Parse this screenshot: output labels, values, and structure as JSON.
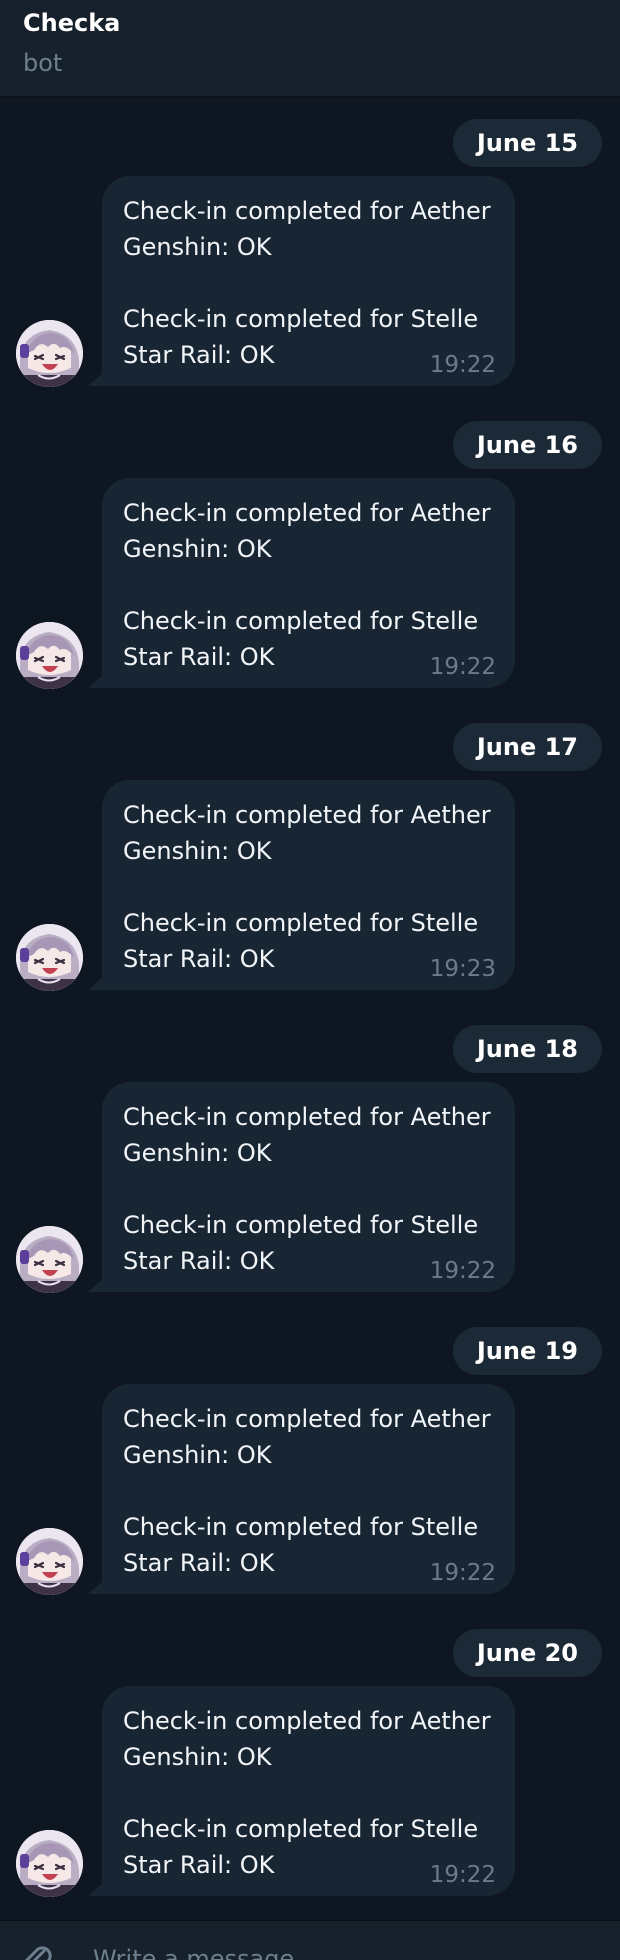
{
  "header": {
    "title": "Checka",
    "subtitle": "bot"
  },
  "messages": [
    {
      "date": "June 15",
      "lines": [
        "Check-in completed for Aether",
        "Genshin: OK",
        "Check-in completed for Stelle",
        "Star Rail: OK"
      ],
      "time": "19:22"
    },
    {
      "date": "June 16",
      "lines": [
        "Check-in completed for Aether",
        "Genshin: OK",
        "Check-in completed for Stelle",
        "Star Rail: OK"
      ],
      "time": "19:22"
    },
    {
      "date": "June 17",
      "lines": [
        "Check-in completed for Aether",
        "Genshin: OK",
        "Check-in completed for Stelle",
        "Star Rail: OK"
      ],
      "time": "19:23"
    },
    {
      "date": "June 18",
      "lines": [
        "Check-in completed for Aether",
        "Genshin: OK",
        "Check-in completed for Stelle",
        "Star Rail: OK"
      ],
      "time": "19:22"
    },
    {
      "date": "June 19",
      "lines": [
        "Check-in completed for Aether",
        "Genshin: OK",
        "Check-in completed for Stelle",
        "Star Rail: OK"
      ],
      "time": "19:22"
    },
    {
      "date": "June 20",
      "lines": [
        "Check-in completed for Aether",
        "Genshin: OK",
        "Check-in completed for Stelle",
        "Star Rail: OK"
      ],
      "time": "19:22"
    }
  ],
  "composer": {
    "placeholder": "Write a message...",
    "attach_icon": "paperclip-icon"
  },
  "colors": {
    "background": "#0e1621",
    "header": "#17212b",
    "bubble": "#182533",
    "date_badge": "#1c2a38",
    "muted_text": "#6d7f8f"
  }
}
